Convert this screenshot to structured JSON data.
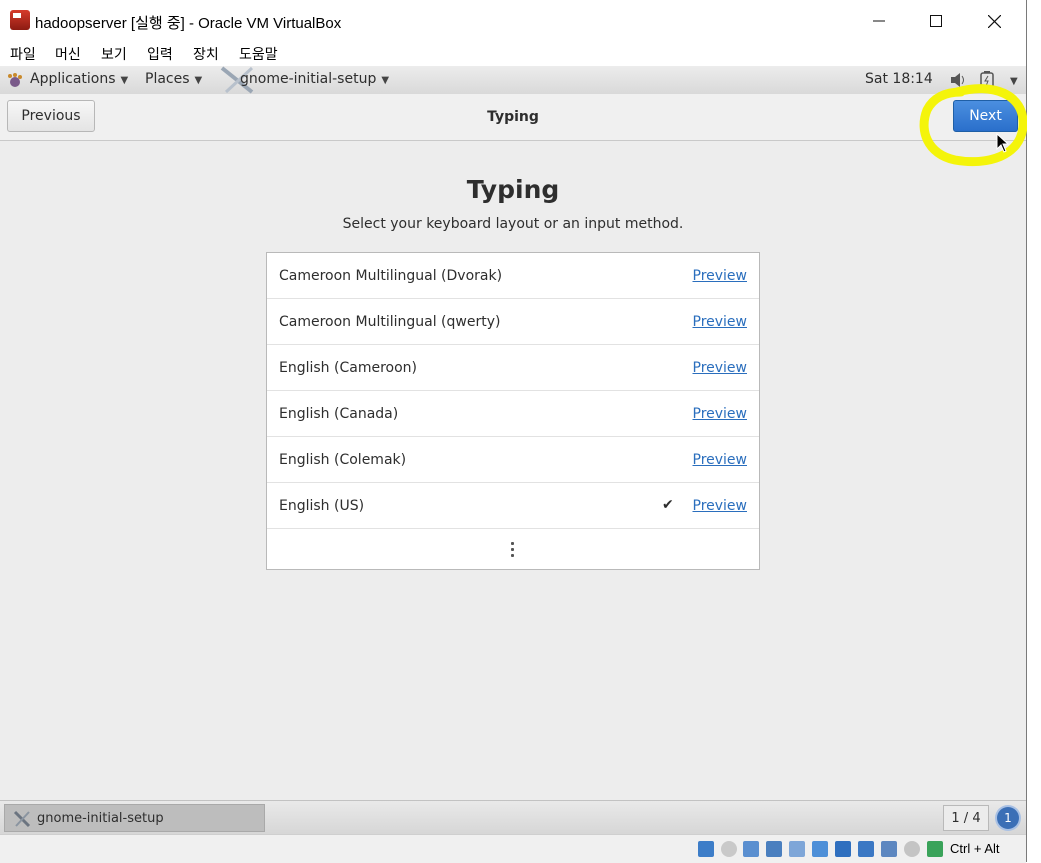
{
  "window": {
    "title": "hadoopserver [실행 중] - Oracle VM VirtualBox",
    "minimize": "—",
    "maximize": "☐",
    "close": "✕"
  },
  "menubar": {
    "items": [
      "파일",
      "머신",
      "보기",
      "입력",
      "장치",
      "도움말"
    ]
  },
  "gnome_panel": {
    "applications": "Applications",
    "places": "Places",
    "app_name": "gnome-initial-setup",
    "clock": "Sat 18:14"
  },
  "header": {
    "previous": "Previous",
    "title": "Typing",
    "next": "Next"
  },
  "page": {
    "heading": "Typing",
    "subtitle": "Select your keyboard layout or an input method.",
    "layouts": [
      {
        "name": "Cameroon Multilingual (Dvorak)",
        "preview": "Preview",
        "selected": false
      },
      {
        "name": "Cameroon Multilingual (qwerty)",
        "preview": "Preview",
        "selected": false
      },
      {
        "name": "English (Cameroon)",
        "preview": "Preview",
        "selected": false
      },
      {
        "name": "English (Canada)",
        "preview": "Preview",
        "selected": false
      },
      {
        "name": "English (Colemak)",
        "preview": "Preview",
        "selected": false
      },
      {
        "name": "English (US)",
        "preview": "Preview",
        "selected": true
      }
    ],
    "check_mark": "✔"
  },
  "taskbar": {
    "task_label": "gnome-initial-setup",
    "workspace": "1 / 4",
    "notification_count": "1"
  },
  "status_bar": {
    "host_key": "Ctrl + Alt"
  },
  "colors": {
    "accent": "#2a6fcb",
    "link": "#2a6ebd",
    "highlight": "#f4f40a"
  }
}
